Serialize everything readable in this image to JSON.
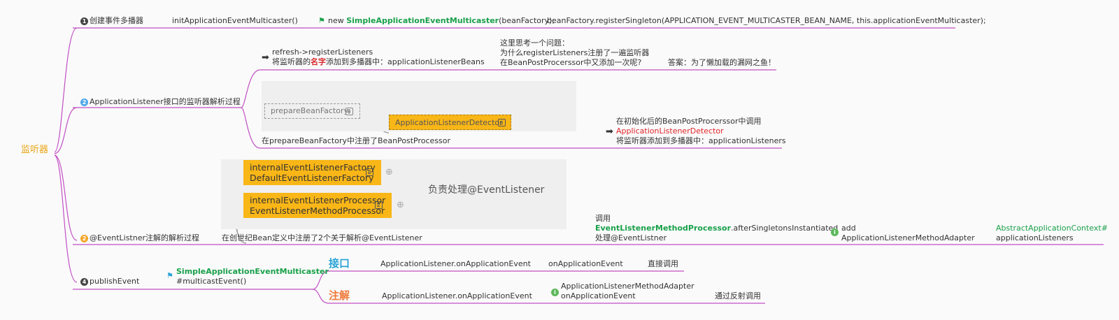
{
  "root": {
    "label": "监听器"
  },
  "b1": {
    "num": "1",
    "label": "创建事件多播器",
    "c1": "initApplicationEventMulticaster()",
    "c2_prefix": "new ",
    "c2_class": "SimpleApplicationEventMulticaster",
    "c2_suffix": "(beanFactory);",
    "c3": "beanFactory.registerSingleton(APPLICATION_EVENT_MULTICASTER_BEAN_NAME, this.applicationEventMulticaster);"
  },
  "b2": {
    "num": "2",
    "label": "ApplicationListener接口的监听器解析过程",
    "r1_line1": "refresh->registerListeners",
    "r1_line2_a": "将监听器的",
    "r1_line2_b": "名字",
    "r1_line2_c": "添加到多播器中：applicationListenerBeans",
    "q1": "这里思考一个问题：",
    "q2": "为什么registerListeners注册了一遍监听器",
    "q3": "在BeanPostProcerssor中又添加一次呢?",
    "answer": "答案：为了懒加载的漏网之鱼！",
    "node_prepare": "prepareBeanFactory",
    "node_detector": "ApplicationListenerDetector",
    "r2_label": "在prepareBeanFactory中注册了BeanPostProcessor",
    "r2_c1": "在初始化后的BeanPostProcerssor中调用",
    "r2_c2": "ApplicationListenerDetector",
    "r2_c3": "将监听器添加到多播器中：applicationListeners"
  },
  "b3": {
    "num": "2",
    "label": "@EventListner注解的解析过程",
    "n1_l1": "internalEventListenerFactory",
    "n1_l2": "DefaultEventListenerFactory",
    "n2_l1": "internalEventListenerProcessor",
    "n2_l2": "EventListenerMethodProcessor",
    "summary": "负责处理@EventListener",
    "r_label": "在创世纪Bean定义中注册了2个关于解析@EventListener",
    "c1_l1": "调用",
    "c1_l2_a": "EventListenerMethodProcessor",
    "c1_l2_b": ".afterSingletonsInstantiated",
    "c1_l3": "处理@EventListner",
    "c2_l1": "add",
    "c2_l2": "ApplicationListenerMethodAdapter",
    "c3_l1": "AbstractApplicationContext#",
    "c3_l2": "applicationListeners"
  },
  "b4": {
    "num": "4",
    "label": "publishEvent",
    "c1_l1": "SimpleApplicationEventMulticaster",
    "c1_l2": "#multicastEvent()",
    "k1": "接口",
    "k1_c1": "ApplicationListener.onApplicationEvent",
    "k1_c2": "onApplicationEvent",
    "k1_c3": "直接调用",
    "k2": "注解",
    "k2_c1": "ApplicationListener.onApplicationEvent",
    "k2_c2_l1": "ApplicationListenerMethodAdapter",
    "k2_c2_l2": "onApplicationEvent",
    "k2_c3": "通过反射调用"
  },
  "colors": {
    "branch": "#c24fc4",
    "gold": "#f9b617",
    "green": "#19a04a",
    "red": "#e0262a",
    "blue": "#29a3d6",
    "orange": "#f07a3a"
  }
}
